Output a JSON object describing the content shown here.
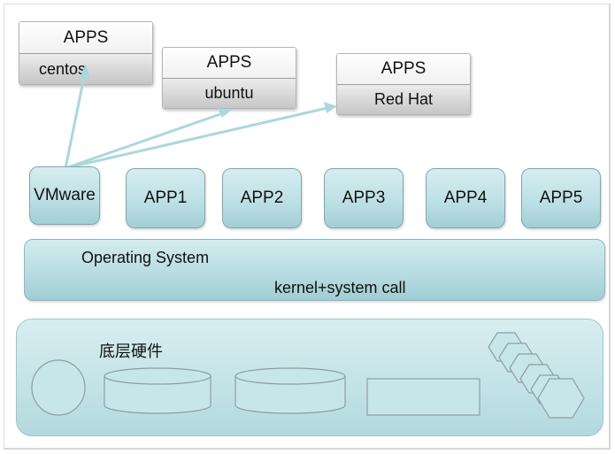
{
  "guests": [
    {
      "apps_label": "APPS",
      "os_label": "centos"
    },
    {
      "apps_label": "APPS",
      "os_label": "ubuntu"
    },
    {
      "apps_label": "APPS",
      "os_label": "Red Hat"
    }
  ],
  "app_layer": {
    "vmware_label": "VMware",
    "apps": [
      "APP1",
      "APP2",
      "APP3",
      "APP4",
      "APP5"
    ]
  },
  "os_layer": {
    "title": "Operating System",
    "subtitle": "kernel+system call"
  },
  "hardware_layer": {
    "title": "底层硬件"
  },
  "colors": {
    "layer_fill": "#bde0e5",
    "layer_border": "#7ea8ae",
    "arrow": "#a9d8dd",
    "hardware_shape": "#c6e6ea"
  }
}
